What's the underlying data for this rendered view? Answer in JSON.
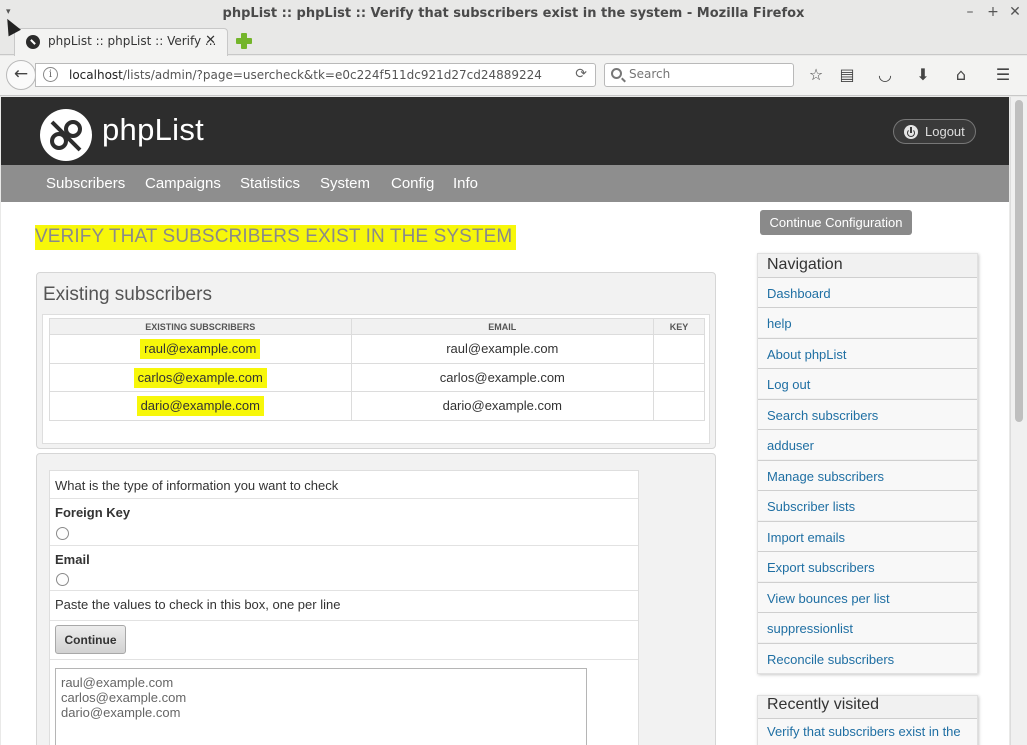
{
  "browser": {
    "window_title": "phpList :: phpList :: Verify that subscribers exist in the system - Mozilla Firefox",
    "window_controls": [
      "–",
      "+",
      "✕"
    ],
    "tab_title": "phpList :: phpList :: Verify ...",
    "tab_close": "✕",
    "url_host": "localhost",
    "url_path": "/lists/admin/?page=usercheck&tk=e0c224f511dc921d27cd24889224",
    "search_placeholder": "Search"
  },
  "header": {
    "logo_text": "phpList",
    "logout_label": "Logout"
  },
  "mainnav": [
    "Subscribers",
    "Campaigns",
    "Statistics",
    "System",
    "Config",
    "Info"
  ],
  "page": {
    "title": "VERIFY THAT SUBSCRIBERS EXIST IN THE SYSTEM",
    "continue_config": "Continue Configuration"
  },
  "existing": {
    "title": "Existing subscribers",
    "columns": [
      "EXISTING SUBSCRIBERS",
      "EMAIL",
      "KEY"
    ],
    "rows": [
      [
        "raul@example.com",
        "raul@example.com",
        ""
      ],
      [
        "carlos@example.com",
        "carlos@example.com",
        ""
      ],
      [
        "dario@example.com",
        "dario@example.com",
        ""
      ]
    ]
  },
  "form": {
    "question": "What is the type of information you want to check",
    "option_foreign_key": "Foreign Key",
    "option_email": "Email",
    "paste_label": "Paste the values to check in this box, one per line",
    "continue_button": "Continue",
    "textarea_value": "raul@example.com\ncarlos@example.com\ndario@example.com"
  },
  "navigation": {
    "title": "Navigation",
    "items": [
      "Dashboard",
      "help",
      "About phpList",
      "Log out",
      "Search subscribers",
      "adduser",
      "Manage subscribers",
      "Subscriber lists",
      "Import emails",
      "Export subscribers",
      "View bounces per list",
      "suppressionlist",
      "Reconcile subscribers"
    ]
  },
  "recently_visited": {
    "title": "Recently visited",
    "items": [
      "Verify that subscribers exist in the"
    ]
  },
  "colors": {
    "highlight": "#f7f70a",
    "header_bg": "#2d2d2d",
    "nav_bg": "#8e8e8e",
    "link": "#1f6fa3"
  }
}
